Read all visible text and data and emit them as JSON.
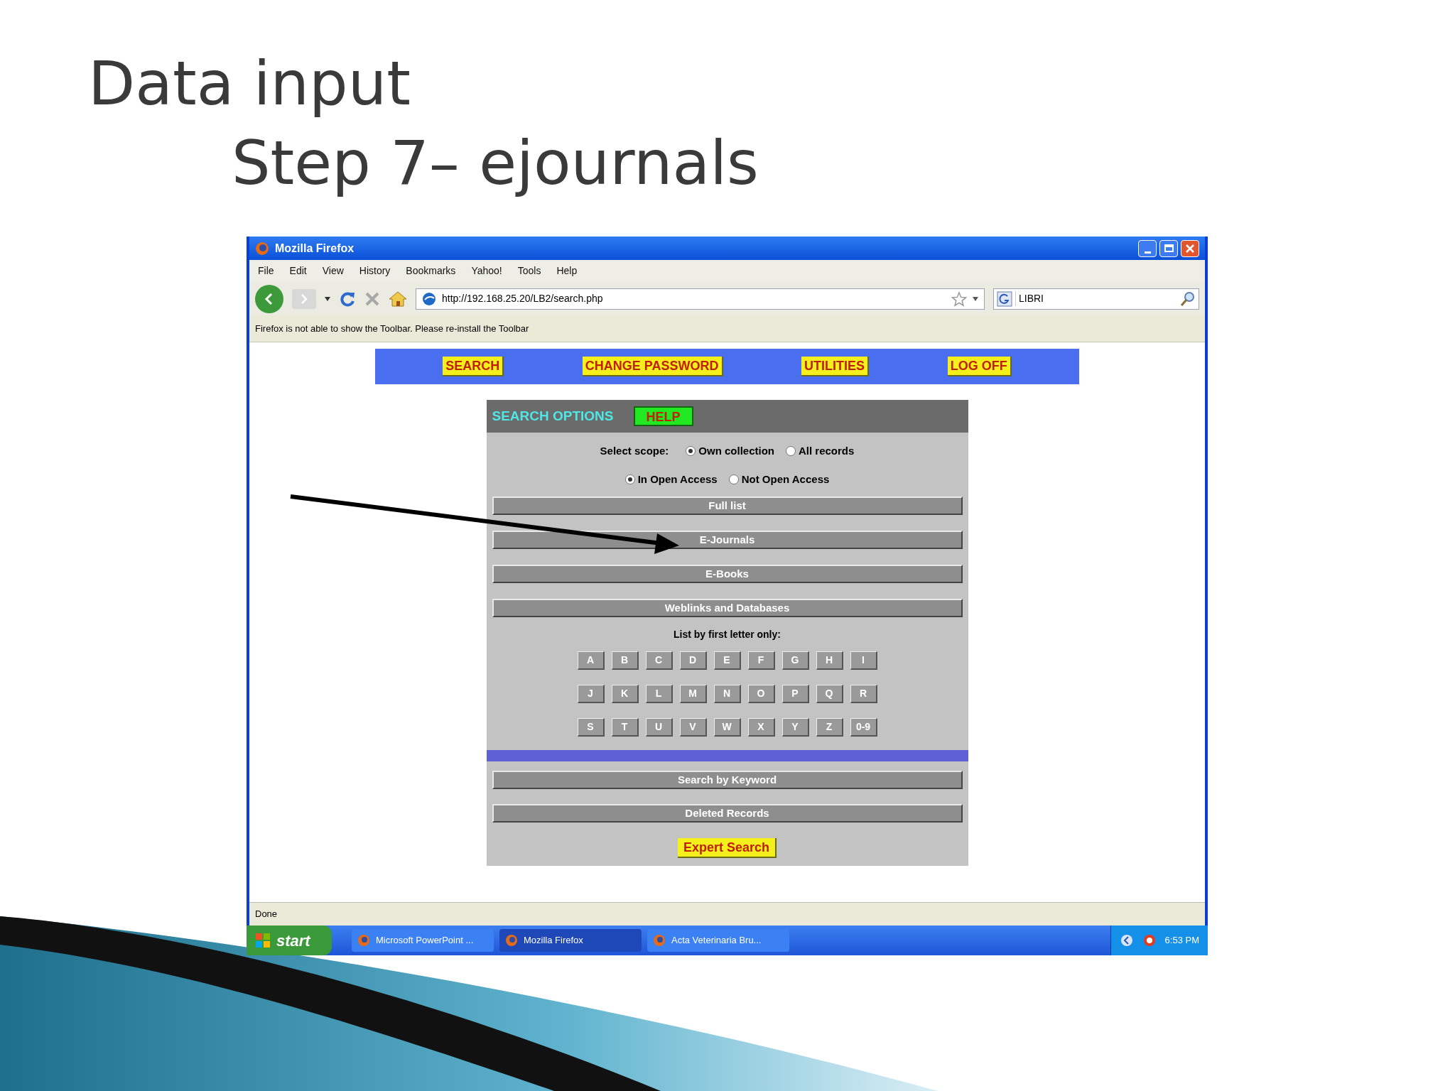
{
  "slide": {
    "title": "Data input",
    "subtitle": "Step 7– ejournals"
  },
  "browser": {
    "window_title": "Mozilla Firefox",
    "menu": [
      "File",
      "Edit",
      "View",
      "History",
      "Bookmarks",
      "Yahoo!",
      "Tools",
      "Help"
    ],
    "address": "http://192.168.25.20/LB2/search.php",
    "search_value": "LIBRI",
    "notification": "Firefox is not able to show the Toolbar. Please re-install the Toolbar",
    "status": "Done"
  },
  "page": {
    "nav": [
      "SEARCH",
      "CHANGE PASSWORD",
      "UTILITIES",
      "LOG OFF"
    ],
    "options_title": "SEARCH OPTIONS",
    "help": "HELP",
    "scope_label": "Select scope:",
    "scope": [
      {
        "label": "Own collection",
        "selected": true
      },
      {
        "label": "All records",
        "selected": false
      }
    ],
    "access": [
      {
        "label": "In Open Access",
        "selected": true
      },
      {
        "label": "Not Open Access",
        "selected": false
      }
    ],
    "buttons_top": [
      "Full list",
      "E-Journals",
      "E-Books",
      "Weblinks and Databases"
    ],
    "letter_label": "List by first letter only:",
    "letters": [
      [
        "A",
        "B",
        "C",
        "D",
        "E",
        "F",
        "G",
        "H",
        "I"
      ],
      [
        "J",
        "K",
        "L",
        "M",
        "N",
        "O",
        "P",
        "Q",
        "R"
      ],
      [
        "S",
        "T",
        "U",
        "V",
        "W",
        "X",
        "Y",
        "Z",
        "0-9"
      ]
    ],
    "buttons_bottom": [
      "Search by Keyword",
      "Deleted Records"
    ],
    "expert": "Expert Search"
  },
  "taskbar": {
    "start": "start",
    "tasks": [
      {
        "label": "Microsoft PowerPoint ...",
        "selected": false
      },
      {
        "label": "Mozilla Firefox",
        "selected": true
      },
      {
        "label": "Acta Veterinaria Bru...",
        "selected": false
      }
    ],
    "clock": "6:53 PM"
  }
}
